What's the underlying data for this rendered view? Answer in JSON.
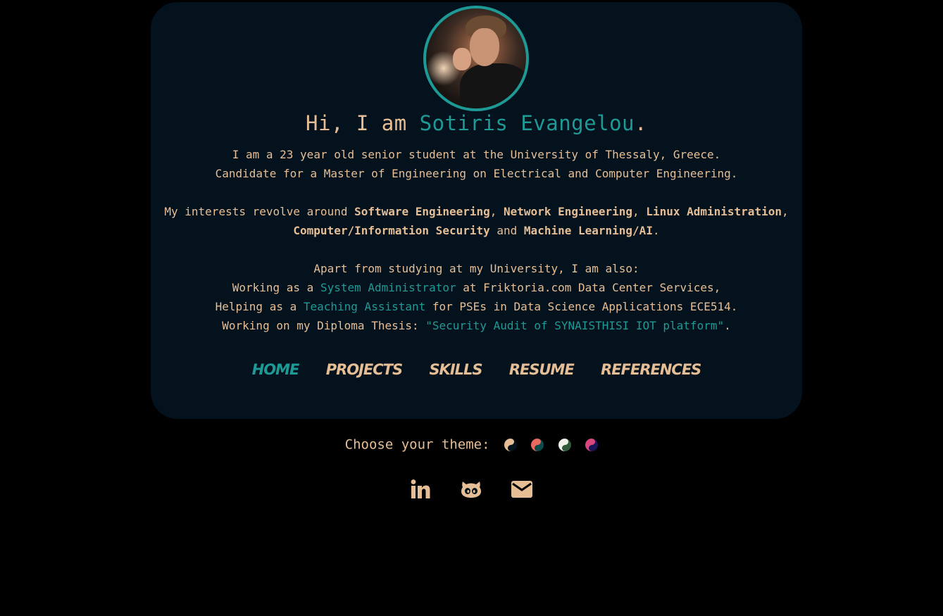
{
  "colors": {
    "background": "#000000",
    "card": "#04121d",
    "text": "#e6be96",
    "accent": "#1e9a96"
  },
  "profile": {
    "avatar_icon": "profile-photo",
    "greeting": "Hi, I am ",
    "name": "Sotiris Evangelou",
    "greeting_end": "."
  },
  "intro": {
    "line1": "I am a 23 year old senior student at the University of Thessaly, Greece.",
    "line2": "Candidate for a Master of Engineering on Electrical and Computer Engineering."
  },
  "interests": {
    "prefix": "My interests revolve around ",
    "items": [
      "Software Engineering",
      "Network Engineering",
      "Linux Administration",
      "Computer/Information Security",
      "Machine Learning/AI"
    ],
    "sep1": ", ",
    "sep2": ", ",
    "sep3": ",",
    "and": " and ",
    "end": "."
  },
  "activities": {
    "intro": "Apart from studying at my University, I am also:",
    "a1_prefix": "Working as a ",
    "a1_link": "System Administrator",
    "a1_suffix": " at Friktoria.com Data Center Services,",
    "a2_prefix": "Helping as a ",
    "a2_link": "Teaching Assistant",
    "a2_suffix": " for PSEs in Data Science Applications ECE514.",
    "a3_prefix": "Working on my Diploma Thesis: ",
    "a3_link": "\"Security Audit of SYNAISTHISI IOT platform\"",
    "a3_suffix": "."
  },
  "nav": {
    "items": [
      "Home",
      "Projects",
      "Skills",
      "Resume",
      "References"
    ],
    "active": "Home"
  },
  "theme": {
    "label": "Choose your theme:",
    "swatches": [
      {
        "name": "theme-sand-dark",
        "c1": "#e6be96",
        "c2": "#04121d"
      },
      {
        "name": "theme-coral-teal",
        "c1": "#e86a5e",
        "c2": "#0e4a4a"
      },
      {
        "name": "theme-white-green",
        "c1": "#f2f2ec",
        "c2": "#2f5b3a"
      },
      {
        "name": "theme-pink-navy",
        "c1": "#d9467e",
        "c2": "#1a1558"
      }
    ]
  },
  "social": {
    "icons": [
      "linkedin-icon",
      "github-icon",
      "email-icon"
    ]
  }
}
